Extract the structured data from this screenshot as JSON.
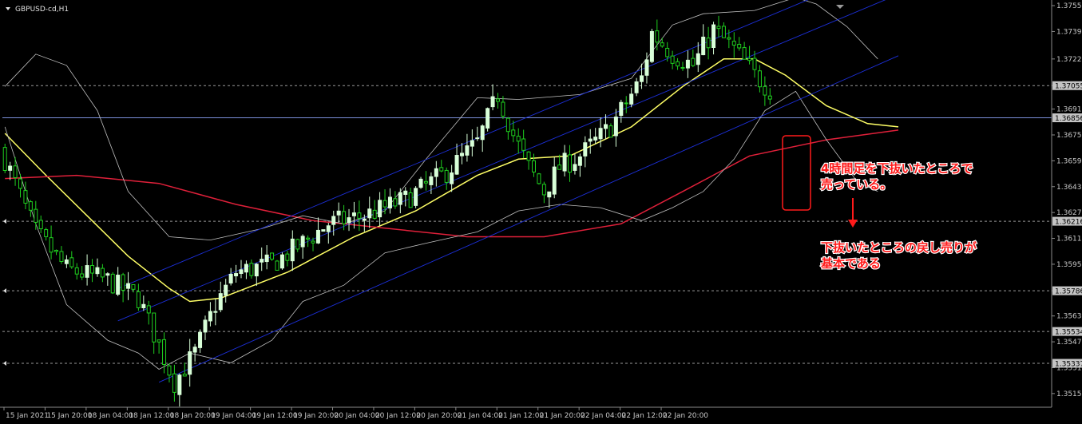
{
  "window": {
    "title": "GBPUSD-cd,H1"
  },
  "colors": {
    "background": "#000000",
    "bull_candle": "#d8ffd8",
    "bear_candle": "#1fcf1f",
    "ma_fast": "#ffff66",
    "ma_slow": "#e0203a",
    "bollinger": "#c0c0c0",
    "channel": "#1c2fd8",
    "annotation": "#ff1a1a",
    "grid_dash": "#9a9a9a"
  },
  "chart_data": {
    "type": "candlestick",
    "symbol": "GBPUSD-cd",
    "timeframe": "H1",
    "ylim": [
      1.3509,
      1.3757
    ],
    "y_ticks": [
      "1.37550",
      "1.37390",
      "1.37220",
      "1.37055",
      "1.36910",
      "1.36750",
      "1.36590",
      "1.36430",
      "1.36270",
      "1.36110",
      "1.35950",
      "1.35786",
      "1.35630",
      "1.35470",
      "1.35310",
      "1.35150"
    ],
    "tagged_levels": [
      {
        "value": 1.37055,
        "label": "1.37055",
        "style": "dashed"
      },
      {
        "value": 1.36856,
        "label": "1.36856",
        "style": "solid"
      },
      {
        "value": 1.36216,
        "label": "1.36216",
        "style": "dashed"
      },
      {
        "value": 1.35786,
        "label": "1.35786",
        "style": "dashed"
      },
      {
        "value": 1.35534,
        "label": "1.35534",
        "style": "dashed"
      },
      {
        "value": 1.35337,
        "label": "1.35337",
        "style": "dashed"
      }
    ],
    "x_labels": [
      "15 Jan 2021",
      "15 Jan 20:00",
      "18 Jan 04:00",
      "18 Jan 12:00",
      "18 Jan 20:00",
      "19 Jan 04:00",
      "19 Jan 12:00",
      "19 Jan 20:00",
      "20 Jan 04:00",
      "20 Jan 12:00",
      "20 Jan 20:00",
      "21 Jan 04:00",
      "21 Jan 12:00",
      "21 Jan 20:00",
      "22 Jan 04:00",
      "22 Jan 12:00",
      "22 Jan 20:00"
    ],
    "bar_count": 150,
    "close_path": [
      [
        0,
        1.366
      ],
      [
        6,
        1.3615
      ],
      [
        12,
        1.3592
      ],
      [
        20,
        1.3585
      ],
      [
        26,
        1.3574
      ],
      [
        30,
        1.3545
      ],
      [
        33,
        1.3522
      ],
      [
        37,
        1.354
      ],
      [
        41,
        1.357
      ],
      [
        45,
        1.359
      ],
      [
        52,
        1.3595
      ],
      [
        58,
        1.3608
      ],
      [
        63,
        1.362
      ],
      [
        70,
        1.3625
      ],
      [
        78,
        1.3635
      ],
      [
        86,
        1.3652
      ],
      [
        92,
        1.367
      ],
      [
        96,
        1.37
      ],
      [
        99,
        1.3675
      ],
      [
        102,
        1.3655
      ],
      [
        105,
        1.364
      ],
      [
        108,
        1.3655
      ],
      [
        112,
        1.3662
      ],
      [
        118,
        1.368
      ],
      [
        124,
        1.371
      ],
      [
        126,
        1.3738
      ],
      [
        130,
        1.3725
      ],
      [
        134,
        1.3718
      ],
      [
        138,
        1.374
      ],
      [
        142,
        1.3728
      ],
      [
        146,
        1.3712
      ],
      [
        150,
        1.37
      ],
      [
        154,
        1.37
      ],
      [
        158,
        1.3676
      ],
      [
        162,
        1.3662
      ],
      [
        164,
        1.3645
      ],
      [
        166,
        1.366
      ],
      [
        169,
        1.3682
      ],
      [
        174,
        1.3685
      ]
    ],
    "series": [
      {
        "type": "line",
        "path": [
          [
            0,
            1.3676
          ],
          [
            8,
            1.365
          ],
          [
            16,
            1.3625
          ],
          [
            24,
            1.36
          ],
          [
            32,
            1.358
          ],
          [
            36,
            1.3572
          ],
          [
            42,
            1.3574
          ],
          [
            55,
            1.359
          ],
          [
            68,
            1.3612
          ],
          [
            80,
            1.3628
          ],
          [
            92,
            1.365
          ],
          [
            100,
            1.366
          ],
          [
            110,
            1.3662
          ],
          [
            122,
            1.368
          ],
          [
            132,
            1.3705
          ],
          [
            140,
            1.3722
          ],
          [
            146,
            1.3722
          ],
          [
            152,
            1.3712
          ],
          [
            160,
            1.3693
          ],
          [
            168,
            1.3682
          ],
          [
            174,
            1.368
          ]
        ]
      },
      {
        "type": "line",
        "path": [
          [
            0,
            1.3648
          ],
          [
            14,
            1.365
          ],
          [
            30,
            1.3645
          ],
          [
            45,
            1.3632
          ],
          [
            60,
            1.3622
          ],
          [
            75,
            1.3617
          ],
          [
            90,
            1.3612
          ],
          [
            105,
            1.3612
          ],
          [
            120,
            1.362
          ],
          [
            132,
            1.364
          ],
          [
            145,
            1.3662
          ],
          [
            160,
            1.3672
          ],
          [
            174,
            1.3678
          ]
        ]
      },
      {
        "type": "line",
        "path": [
          [
            0,
            1.3705
          ],
          [
            6,
            1.3725
          ],
          [
            12,
            1.3718
          ],
          [
            18,
            1.369
          ],
          [
            24,
            1.364
          ],
          [
            32,
            1.3612
          ],
          [
            40,
            1.361
          ],
          [
            50,
            1.3617
          ],
          [
            58,
            1.3625
          ],
          [
            66,
            1.362
          ],
          [
            74,
            1.3628
          ],
          [
            82,
            1.366
          ],
          [
            92,
            1.3698
          ],
          [
            100,
            1.3697
          ],
          [
            112,
            1.37
          ],
          [
            122,
            1.371
          ],
          [
            130,
            1.3743
          ],
          [
            136,
            1.375
          ],
          [
            146,
            1.3752
          ],
          [
            154,
            1.376
          ],
          [
            158,
            1.3756
          ],
          [
            164,
            1.3742
          ],
          [
            170,
            1.3722
          ]
        ]
      },
      {
        "type": "line",
        "path": [
          [
            0,
            1.368
          ],
          [
            6,
            1.362
          ],
          [
            12,
            1.357
          ],
          [
            20,
            1.3548
          ],
          [
            26,
            1.354
          ],
          [
            30,
            1.353
          ],
          [
            36,
            1.354
          ],
          [
            44,
            1.3534
          ],
          [
            52,
            1.3548
          ],
          [
            58,
            1.3572
          ],
          [
            66,
            1.3582
          ],
          [
            74,
            1.3602
          ],
          [
            82,
            1.3608
          ],
          [
            92,
            1.3615
          ],
          [
            100,
            1.3628
          ],
          [
            108,
            1.3632
          ],
          [
            116,
            1.363
          ],
          [
            124,
            1.3622
          ],
          [
            130,
            1.363
          ],
          [
            136,
            1.364
          ],
          [
            142,
            1.366
          ],
          [
            148,
            1.369
          ],
          [
            154,
            1.3702
          ],
          [
            160,
            1.3672
          ],
          [
            166,
            1.3646
          ],
          [
            170,
            1.364
          ]
        ]
      },
      {
        "type": "line",
        "path": [
          [
            22,
            1.356
          ],
          [
            174,
            1.3762
          ]
        ]
      },
      {
        "type": "line",
        "path": [
          [
            22,
            1.358
          ],
          [
            174,
            1.3782
          ]
        ]
      },
      {
        "type": "line",
        "path": [
          [
            30,
            1.3522
          ],
          [
            174,
            1.3724
          ]
        ]
      }
    ],
    "annotations": [
      {
        "lines": [
          "4時間足を下抜いたところで",
          "売っている。"
        ]
      },
      {
        "lines": [
          "下抜いたところの戻し売りが",
          "基本である"
        ]
      }
    ]
  }
}
